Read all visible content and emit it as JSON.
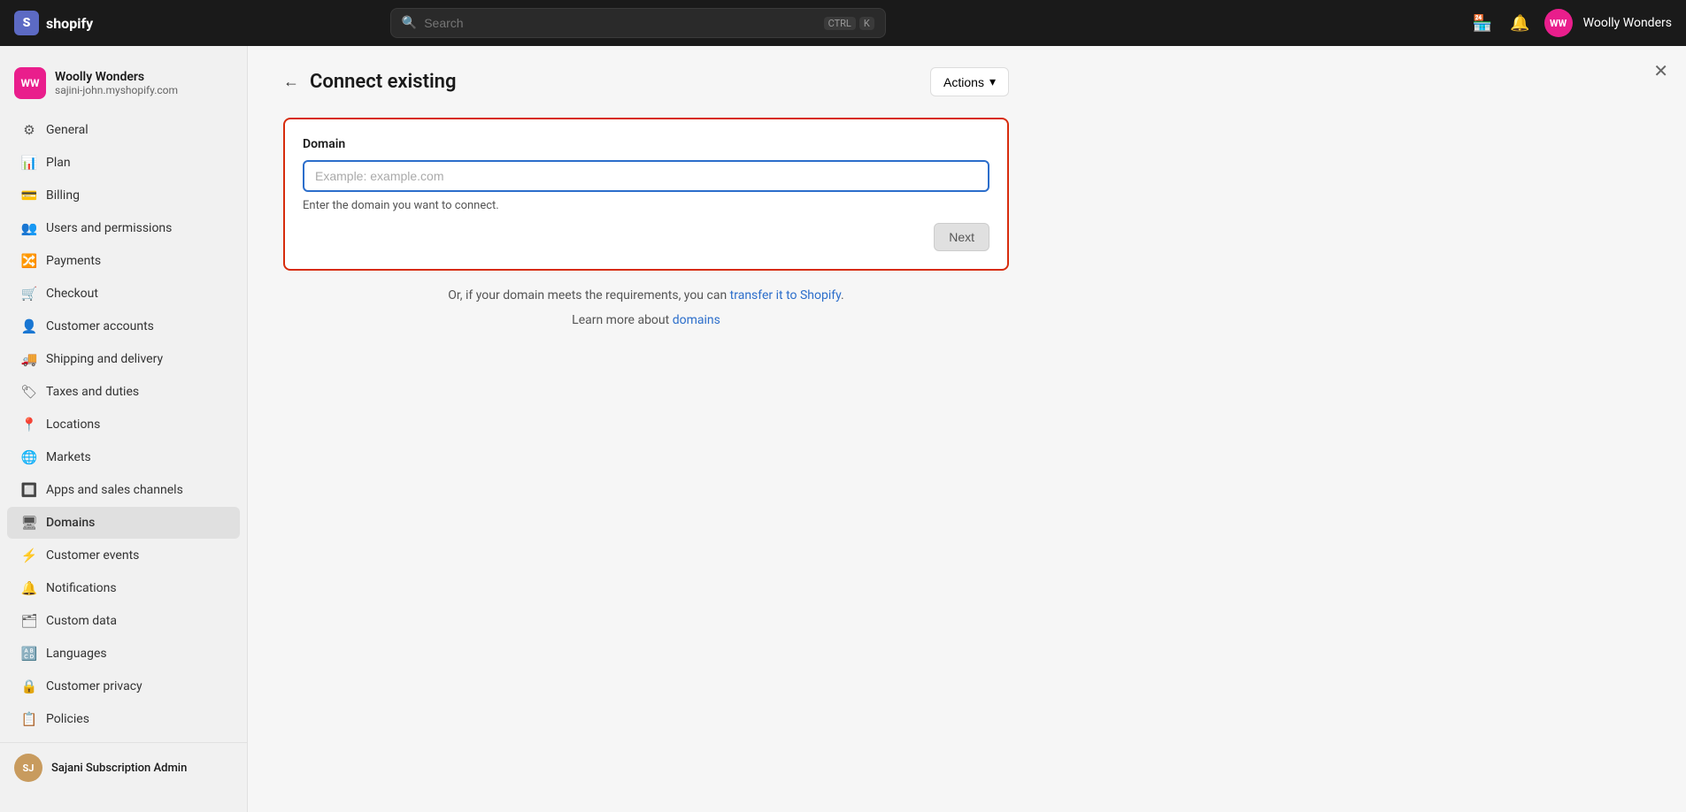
{
  "topnav": {
    "logo_text": "shopify",
    "search_placeholder": "Search",
    "search_hint_key": "CTRL",
    "search_hint_key2": "K",
    "store_name": "Woolly Wonders",
    "avatar_initials": "WW"
  },
  "sidebar": {
    "store_name": "Woolly Wonders",
    "store_url": "sajini-john.myshopify.com",
    "store_initials": "WW",
    "nav_items": [
      {
        "id": "general",
        "label": "General",
        "icon": "⚙"
      },
      {
        "id": "plan",
        "label": "Plan",
        "icon": "📊"
      },
      {
        "id": "billing",
        "label": "Billing",
        "icon": "💳"
      },
      {
        "id": "users",
        "label": "Users and permissions",
        "icon": "👥"
      },
      {
        "id": "payments",
        "label": "Payments",
        "icon": "🔀"
      },
      {
        "id": "checkout",
        "label": "Checkout",
        "icon": "🛒"
      },
      {
        "id": "customer-accounts",
        "label": "Customer accounts",
        "icon": "👤"
      },
      {
        "id": "shipping",
        "label": "Shipping and delivery",
        "icon": "🚚"
      },
      {
        "id": "taxes",
        "label": "Taxes and duties",
        "icon": "🏷"
      },
      {
        "id": "locations",
        "label": "Locations",
        "icon": "📍"
      },
      {
        "id": "markets",
        "label": "Markets",
        "icon": "🌐"
      },
      {
        "id": "apps",
        "label": "Apps and sales channels",
        "icon": "🔲"
      },
      {
        "id": "domains",
        "label": "Domains",
        "icon": "🖥"
      },
      {
        "id": "customer-events",
        "label": "Customer events",
        "icon": "⚡"
      },
      {
        "id": "notifications",
        "label": "Notifications",
        "icon": "🔔"
      },
      {
        "id": "custom-data",
        "label": "Custom data",
        "icon": "🗂"
      },
      {
        "id": "languages",
        "label": "Languages",
        "icon": "🔠"
      },
      {
        "id": "customer-privacy",
        "label": "Customer privacy",
        "icon": "🔒"
      },
      {
        "id": "policies",
        "label": "Policies",
        "icon": "📋"
      }
    ],
    "footer_initials": "SJ",
    "footer_name": "Sajani Subscription Admin"
  },
  "page": {
    "back_label": "←",
    "title": "Connect existing",
    "actions_label": "Actions",
    "actions_chevron": "▾",
    "domain_section": {
      "label": "Domain",
      "input_placeholder": "Example: example.com",
      "hint": "Enter the domain you want to connect.",
      "next_btn": "Next"
    },
    "transfer_text_before": "Or, if your domain meets the requirements, you can ",
    "transfer_link_text": "transfer it to Shopify",
    "transfer_text_after": ".",
    "learn_more_before": "Learn more about ",
    "learn_more_link": "domains"
  }
}
